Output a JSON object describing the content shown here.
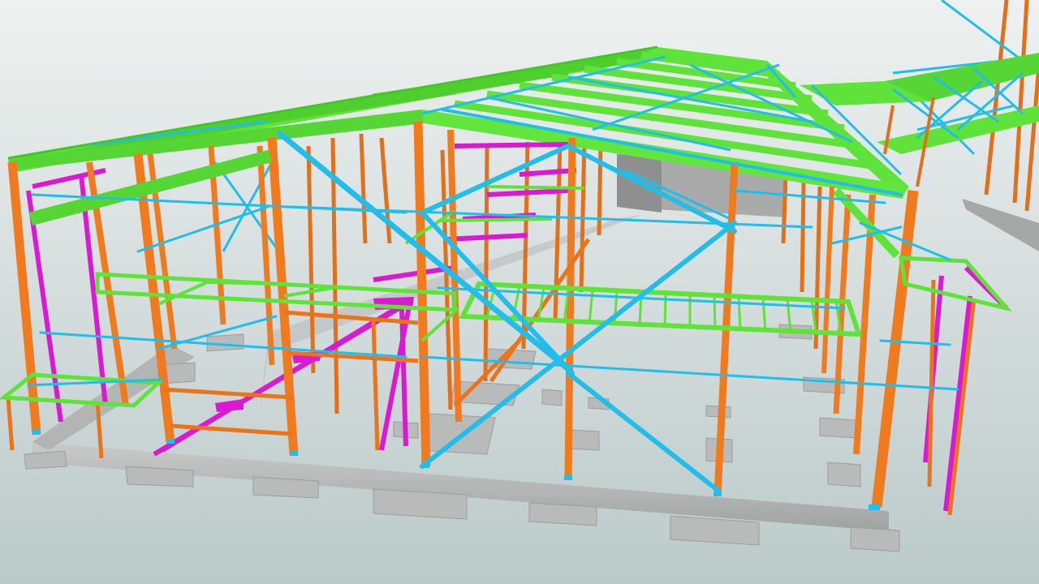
{
  "viewport": {
    "background_top": "#eef1f0",
    "background_bottom": "#bccaca"
  },
  "legend_colors": {
    "columns_and_girts": "#f07a1e",
    "rafters_and_purlins": "#5fe23a",
    "bracing": "#23c2ee",
    "secondary_framing": "#d81bd0",
    "concrete_foundations": "#b9bcba"
  }
}
